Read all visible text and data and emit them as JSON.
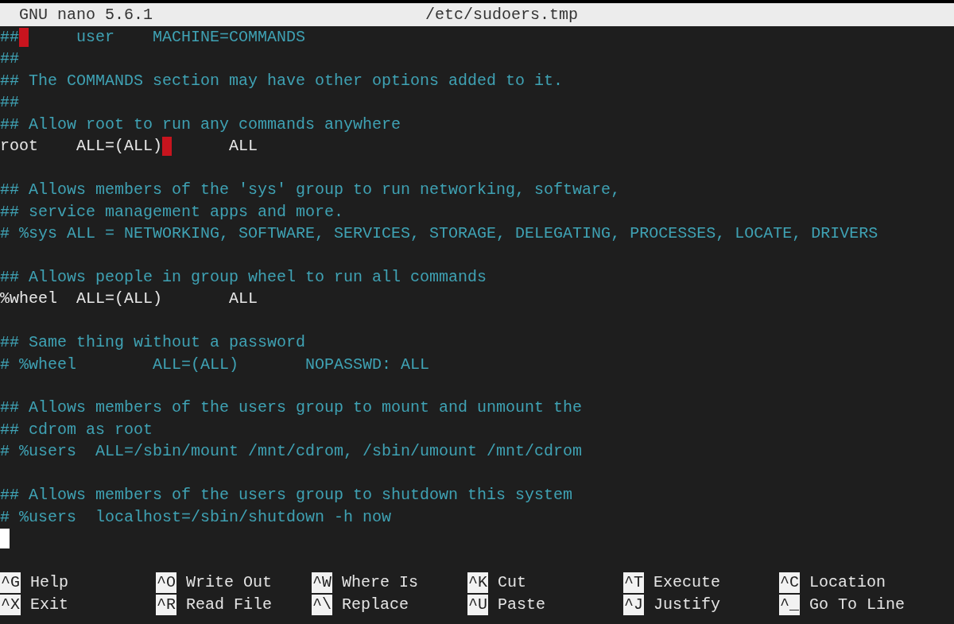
{
  "title_bar": {
    "version": "GNU nano 5.6.1",
    "filename": "/etc/sudoers.tmp"
  },
  "lines": [
    {
      "kind": "text",
      "cursor": false,
      "segments": [
        {
          "kind": "comment",
          "text": "##"
        },
        {
          "kind": "mark"
        },
        {
          "kind": "comment",
          "text": "     user    MACHINE=COMMANDS"
        }
      ]
    },
    {
      "kind": "text",
      "cursor": false,
      "segments": [
        {
          "kind": "comment",
          "text": "##"
        }
      ]
    },
    {
      "kind": "text",
      "cursor": false,
      "segments": [
        {
          "kind": "comment",
          "text": "## The COMMANDS section may have other options added to it."
        }
      ]
    },
    {
      "kind": "text",
      "cursor": false,
      "segments": [
        {
          "kind": "comment",
          "text": "##"
        }
      ]
    },
    {
      "kind": "text",
      "cursor": false,
      "segments": [
        {
          "kind": "comment",
          "text": "## Allow root to run any commands anywhere"
        }
      ]
    },
    {
      "kind": "text",
      "cursor": false,
      "segments": [
        {
          "kind": "code",
          "text": "root    ALL=(ALL)"
        },
        {
          "kind": "mark"
        },
        {
          "kind": "code",
          "text": "      ALL"
        }
      ]
    },
    {
      "kind": "blank",
      "cursor": false
    },
    {
      "kind": "text",
      "cursor": false,
      "segments": [
        {
          "kind": "comment",
          "text": "## Allows members of the 'sys' group to run networking, software,"
        }
      ]
    },
    {
      "kind": "text",
      "cursor": false,
      "segments": [
        {
          "kind": "comment",
          "text": "## service management apps and more."
        }
      ]
    },
    {
      "kind": "text",
      "cursor": false,
      "segments": [
        {
          "kind": "comment",
          "text": "# %sys ALL = NETWORKING, SOFTWARE, SERVICES, STORAGE, DELEGATING, PROCESSES, LOCATE, DRIVERS"
        }
      ]
    },
    {
      "kind": "blank",
      "cursor": false
    },
    {
      "kind": "text",
      "cursor": false,
      "segments": [
        {
          "kind": "comment",
          "text": "## Allows people in group wheel to run all commands"
        }
      ]
    },
    {
      "kind": "text",
      "cursor": false,
      "segments": [
        {
          "kind": "code",
          "text": "%wheel  ALL=(ALL)       ALL"
        }
      ]
    },
    {
      "kind": "blank",
      "cursor": false
    },
    {
      "kind": "text",
      "cursor": false,
      "segments": [
        {
          "kind": "comment",
          "text": "## Same thing without a password"
        }
      ]
    },
    {
      "kind": "text",
      "cursor": false,
      "segments": [
        {
          "kind": "comment",
          "text": "# %wheel        ALL=(ALL)       NOPASSWD: ALL"
        }
      ]
    },
    {
      "kind": "blank",
      "cursor": false
    },
    {
      "kind": "text",
      "cursor": false,
      "segments": [
        {
          "kind": "comment",
          "text": "## Allows members of the users group to mount and unmount the"
        }
      ]
    },
    {
      "kind": "text",
      "cursor": false,
      "segments": [
        {
          "kind": "comment",
          "text": "## cdrom as root"
        }
      ]
    },
    {
      "kind": "text",
      "cursor": false,
      "segments": [
        {
          "kind": "comment",
          "text": "# %users  ALL=/sbin/mount /mnt/cdrom, /sbin/umount /mnt/cdrom"
        }
      ]
    },
    {
      "kind": "blank",
      "cursor": false
    },
    {
      "kind": "text",
      "cursor": false,
      "segments": [
        {
          "kind": "comment",
          "text": "## Allows members of the users group to shutdown this system"
        }
      ]
    },
    {
      "kind": "text",
      "cursor": false,
      "segments": [
        {
          "kind": "comment",
          "text": "# %users  localhost=/sbin/shutdown -h now"
        }
      ]
    },
    {
      "kind": "blank",
      "cursor": true
    }
  ],
  "shortcuts": [
    [
      {
        "key": "^G",
        "label": "Help"
      },
      {
        "key": "^X",
        "label": "Exit"
      }
    ],
    [
      {
        "key": "^O",
        "label": "Write Out"
      },
      {
        "key": "^R",
        "label": "Read File"
      }
    ],
    [
      {
        "key": "^W",
        "label": "Where Is"
      },
      {
        "key": "^\\",
        "label": "Replace"
      }
    ],
    [
      {
        "key": "^K",
        "label": "Cut"
      },
      {
        "key": "^U",
        "label": "Paste"
      }
    ],
    [
      {
        "key": "^T",
        "label": "Execute"
      },
      {
        "key": "^J",
        "label": "Justify"
      }
    ],
    [
      {
        "key": "^C",
        "label": "Location"
      },
      {
        "key": "^_",
        "label": "Go To Line"
      }
    ]
  ]
}
